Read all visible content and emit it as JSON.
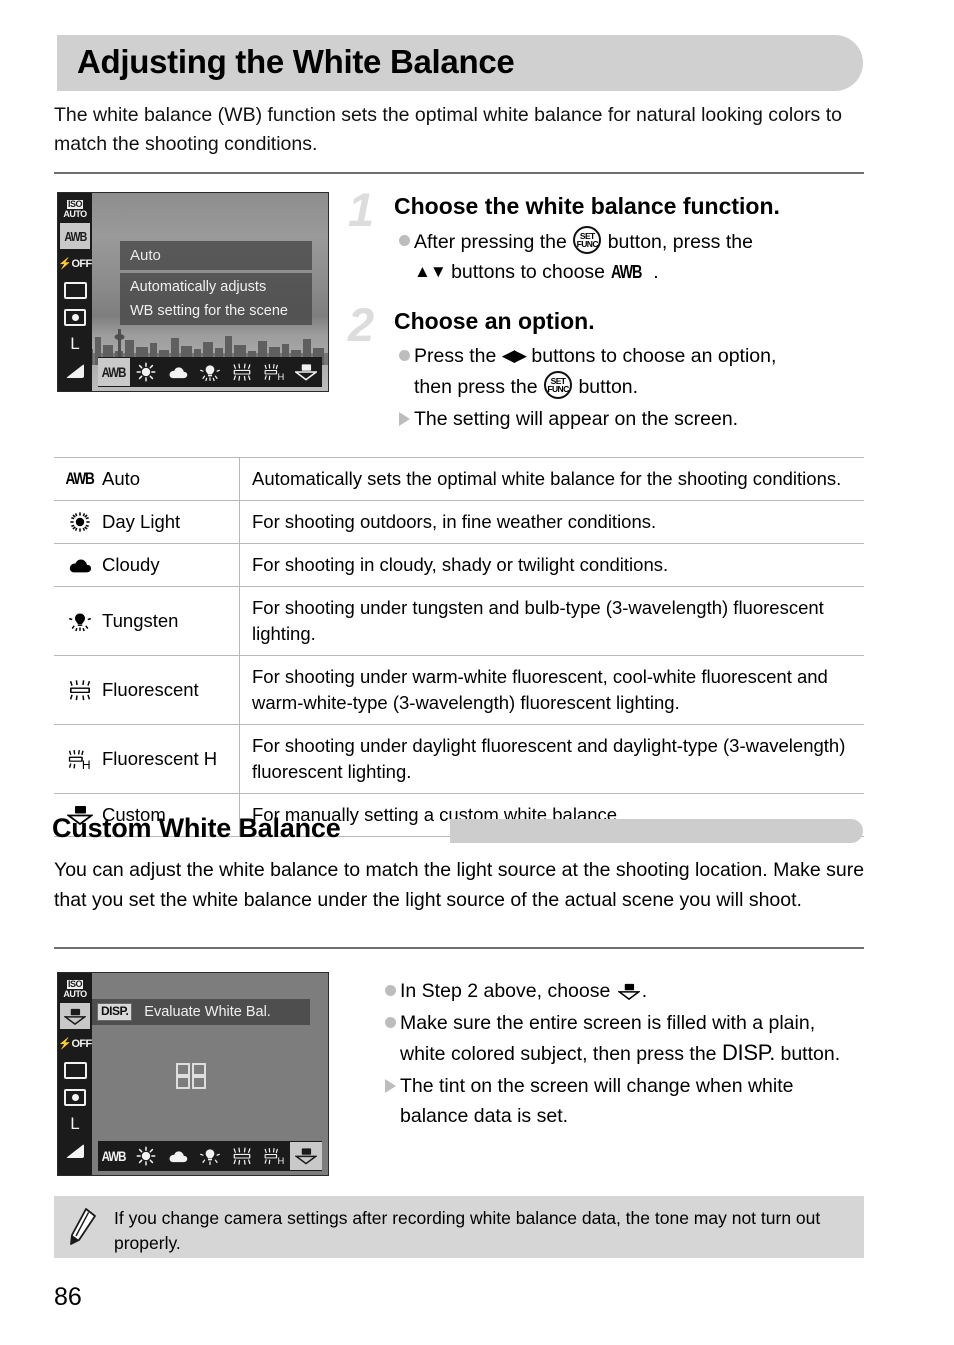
{
  "page": {
    "title": "Adjusting the White Balance",
    "intro": "The white balance (WB) function sets the optimal white balance for natural looking colors to match the shooting conditions.",
    "page_number": "86"
  },
  "steps": [
    {
      "number": "1",
      "heading": "Choose the white balance function.",
      "bullets": [
        {
          "marker": "dot",
          "parts": [
            "After pressing the ",
            "FUNC-SET-button",
            " button, press the ",
            "up-down-buttons",
            " buttons to choose ",
            "awb-icon",
            "."
          ]
        }
      ]
    },
    {
      "number": "2",
      "heading": "Choose an option.",
      "bullets": [
        {
          "marker": "dot",
          "parts": [
            "Press the ",
            "left-right-buttons",
            " buttons to choose an option, then press the ",
            "FUNC-SET-button",
            " button."
          ]
        },
        {
          "marker": "triangle",
          "parts": [
            "The setting will appear on the screen."
          ]
        }
      ]
    }
  ],
  "step1_bullet": {
    "t1": "After pressing the",
    "t2": "button, press the",
    "t3": "buttons to choose",
    "t4": "."
  },
  "step2_bullet1": {
    "t1": "Press the",
    "t2": "buttons to choose an option,",
    "t3": "then press the",
    "t4": "button."
  },
  "step2_bullet2": {
    "t1": "The setting will appear on the screen."
  },
  "screen1": {
    "sidebar": [
      {
        "name": "iso-auto",
        "top": "ISO",
        "bottom": "AUTO",
        "selected": false
      },
      {
        "name": "awb",
        "label": "AWB",
        "selected": true
      },
      {
        "name": "flash-off",
        "label": "OFF",
        "selected": false
      },
      {
        "name": "drive-single",
        "label": "",
        "selected": false
      },
      {
        "name": "metering",
        "label": "",
        "selected": false
      },
      {
        "name": "image-size-large",
        "label": "L",
        "selected": false
      },
      {
        "name": "compression",
        "label": "",
        "selected": false
      }
    ],
    "popup_title": "Auto",
    "popup_line1": "Automatically adjusts",
    "popup_line2": "WB setting for the scene",
    "strip": [
      "AWB",
      "daylight",
      "cloudy",
      "tungsten",
      "fluorescent",
      "fluorescent-h",
      "custom"
    ],
    "strip_selected_index": 0
  },
  "screen2": {
    "sidebar": [
      {
        "name": "iso-auto",
        "top": "ISO",
        "bottom": "AUTO",
        "selected": false
      },
      {
        "name": "custom-wb",
        "label": "",
        "selected": true
      },
      {
        "name": "flash-off",
        "label": "OFF",
        "selected": false
      },
      {
        "name": "drive-single",
        "label": "",
        "selected": false
      },
      {
        "name": "metering",
        "label": "",
        "selected": false
      },
      {
        "name": "image-size-large",
        "label": "L",
        "selected": false
      },
      {
        "name": "compression",
        "label": "",
        "selected": false
      }
    ],
    "disp_badge": "DISP.",
    "disp_label": "Evaluate White Bal.",
    "strip": [
      "AWB",
      "daylight",
      "cloudy",
      "tungsten",
      "fluorescent",
      "fluorescent-h",
      "custom"
    ],
    "strip_selected_index": 6
  },
  "table": {
    "rows": [
      {
        "icon": "awb",
        "label": "Auto",
        "desc": "Automatically sets the optimal white balance for the shooting conditions."
      },
      {
        "icon": "daylight",
        "label": "Day Light",
        "desc": "For shooting outdoors, in fine weather conditions."
      },
      {
        "icon": "cloudy",
        "label": "Cloudy",
        "desc": "For shooting in cloudy, shady or twilight conditions."
      },
      {
        "icon": "tungsten",
        "label": "Tungsten",
        "desc": "For shooting under tungsten and bulb-type (3-wavelength) fluorescent lighting."
      },
      {
        "icon": "fluorescent",
        "label": "Fluorescent",
        "desc": "For shooting under warm-white fluorescent, cool-white fluorescent and warm-white-type (3-wavelength) fluorescent lighting."
      },
      {
        "icon": "fluorescent-h",
        "label": "Fluorescent H",
        "desc": "For shooting under daylight fluorescent and daylight-type (3-wavelength) fluorescent lighting."
      },
      {
        "icon": "custom",
        "label": "Custom",
        "desc": "For manually setting a custom white balance."
      }
    ]
  },
  "section2": {
    "title": "Custom White Balance",
    "body": "You can adjust the white balance to match the light source at the shooting location. Make sure that you set the white balance under the light source of the actual scene you will shoot.",
    "bullet1": {
      "t1": "In Step 2 above, choose",
      "t2": "."
    },
    "bullet2": {
      "t1": "Make sure the entire screen is filled with a plain, white colored subject, then press the",
      "t2": "button."
    },
    "bullet3": {
      "t1": "The tint on the screen will change when white balance data is set."
    },
    "disp_label": "DISP."
  },
  "note": {
    "text": "If you change camera settings after recording white balance data, the tone may not turn out properly."
  },
  "colors": {
    "banner_gray": "#d0d0d0",
    "step_number_gray": "#dcdcdc",
    "bullet_gray": "#bdbdbd",
    "note_bg": "#d6d6d6",
    "table_line": "#b9b9b9"
  }
}
